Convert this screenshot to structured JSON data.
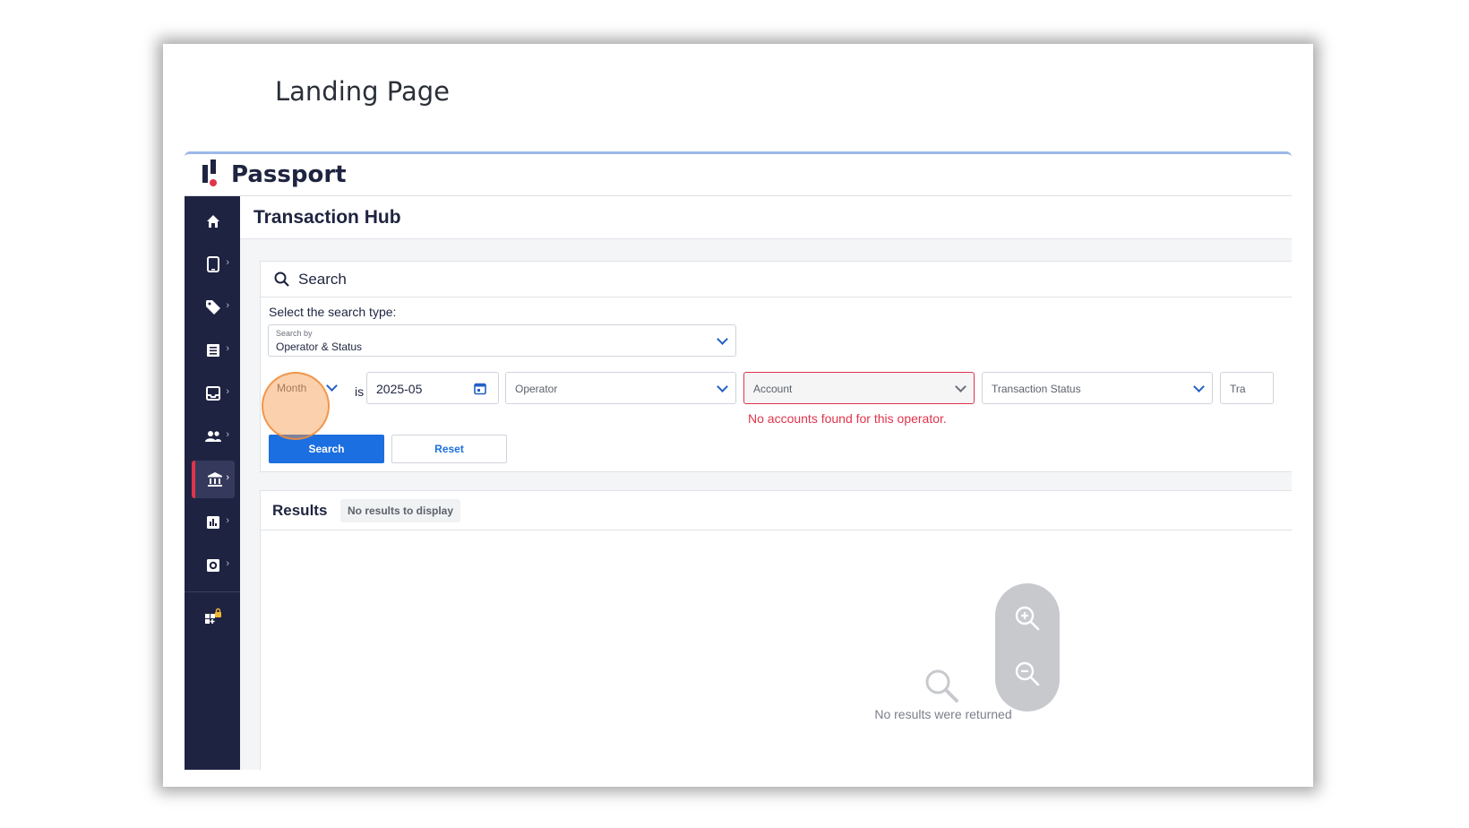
{
  "page_title": "Landing Page",
  "brand": {
    "name": "Passport",
    "accent": "#e0344b",
    "primary": "#1c6fe0",
    "sidebar_bg": "#1f2342"
  },
  "sidebar": {
    "items": [
      {
        "icon": "home-icon",
        "has_chevron": false,
        "active": false
      },
      {
        "icon": "mobile-device-icon",
        "has_chevron": true,
        "active": false
      },
      {
        "icon": "tag-icon",
        "has_chevron": true,
        "active": false
      },
      {
        "icon": "list-icon",
        "has_chevron": true,
        "active": false
      },
      {
        "icon": "inbox-icon",
        "has_chevron": true,
        "active": false
      },
      {
        "icon": "people-icon",
        "has_chevron": true,
        "active": false
      },
      {
        "icon": "bank-icon",
        "has_chevron": true,
        "active": true
      },
      {
        "icon": "bar-chart-icon",
        "has_chevron": true,
        "active": false
      },
      {
        "icon": "settings-icon",
        "has_chevron": true,
        "active": false
      },
      {
        "icon": "locked-apps-icon",
        "has_chevron": false,
        "active": false
      }
    ]
  },
  "main": {
    "title": "Transaction Hub",
    "search": {
      "title": "Search",
      "type_prompt": "Select the search type:",
      "search_by_label": "Search by",
      "search_by_value": "Operator & Status",
      "period_value": "Month",
      "is_text": "is",
      "date_value": "2025-05",
      "operator_placeholder": "Operator",
      "account_placeholder": "Account",
      "status_placeholder": "Transaction Status",
      "extra_placeholder": "Tra",
      "error": "No accounts found for this operator.",
      "search_button": "Search",
      "reset_button": "Reset"
    },
    "results": {
      "title": "Results",
      "badge": "No results to display",
      "empty_text": "No results were returned"
    }
  },
  "zoom": {
    "in_icon": "zoom-in-icon",
    "out_icon": "zoom-out-icon"
  }
}
